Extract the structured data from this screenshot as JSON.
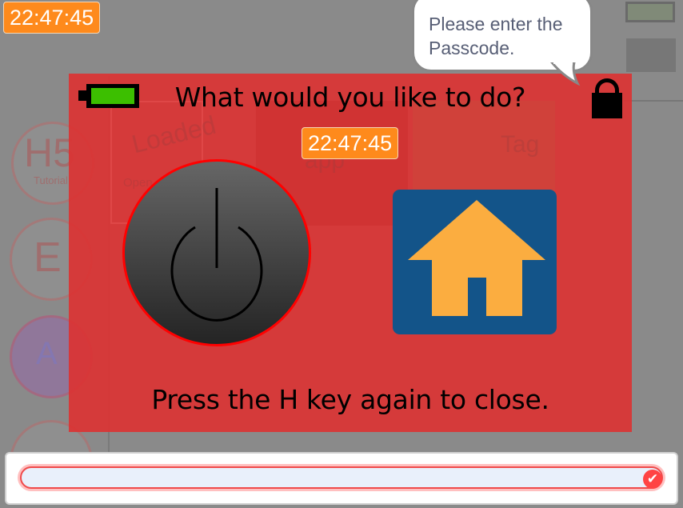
{
  "timer": "22:47:45",
  "background": {
    "card_loaded": "Loaded",
    "card_loaded_sub": "Open",
    "card_app": "app",
    "card_tag": "Tag",
    "circle_h5": "H5",
    "circle_h5_sub": "Tutorial",
    "circle_e": "E",
    "circle_a": "A"
  },
  "speech_bubble": {
    "text": "Please enter the Passcode."
  },
  "dialog": {
    "question": "What would you like to do?",
    "timer": "22:47:45",
    "instruction": "Press the H key again to close.",
    "battery_level": 1.0,
    "icons": {
      "battery": "battery-icon",
      "lock": "lock-icon",
      "power": "power-icon",
      "home": "home-icon"
    }
  },
  "answer_input": {
    "value": "",
    "submit_icon": "checkmark-icon"
  },
  "colors": {
    "dialog_bg": "#da3434",
    "timer_bg": "#fe8a1c",
    "home_bg": "#135489",
    "home_house": "#fbad40",
    "battery_fill": "#3cbf00"
  }
}
